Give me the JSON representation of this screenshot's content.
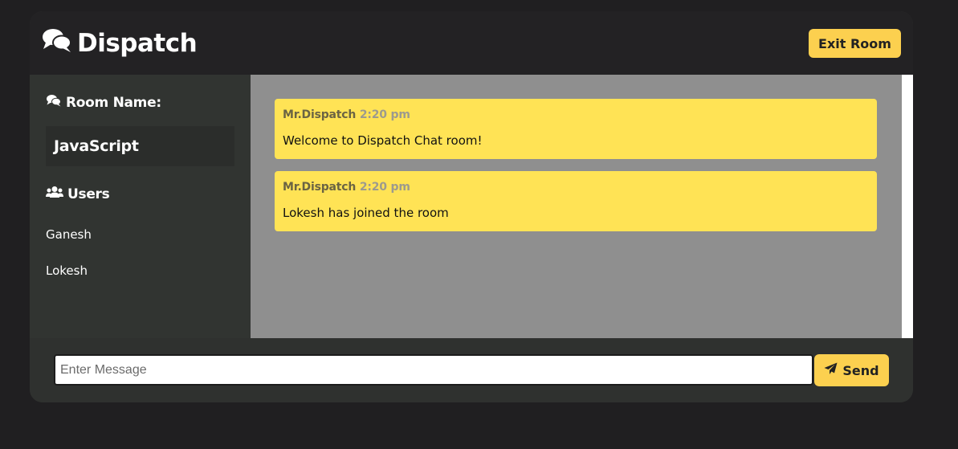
{
  "header": {
    "app_title": "Dispatch",
    "exit_label": "Exit Room"
  },
  "sidebar": {
    "room_heading": "Room Name:",
    "room_name": "JavaScript",
    "users_heading": "Users",
    "users": [
      "Ganesh",
      "Lokesh"
    ]
  },
  "messages": [
    {
      "author": "Mr.Dispatch",
      "time": "2:20 pm",
      "text": "Welcome to Dispatch Chat room!"
    },
    {
      "author": "Mr.Dispatch",
      "time": "2:20 pm",
      "text": "Lokesh has joined the room"
    }
  ],
  "composer": {
    "placeholder": "Enter Message",
    "value": "",
    "send_label": "Send"
  },
  "colors": {
    "accent": "#fcd04f",
    "message_bg": "#ffe355",
    "panel": "#2f312f"
  }
}
